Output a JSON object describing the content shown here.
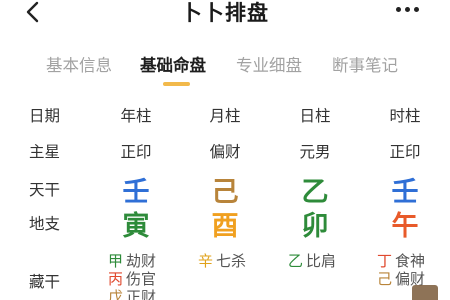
{
  "header": {
    "title": "卜卜排盘",
    "back_icon": "chevron-left-icon",
    "more_icon": "more-horizontal-icon"
  },
  "tabs": [
    {
      "label": "基本信息",
      "active": false
    },
    {
      "label": "基础命盘",
      "active": true
    },
    {
      "label": "专业细盘",
      "active": false
    },
    {
      "label": "断事笔记",
      "active": false
    }
  ],
  "row_labels": {
    "date": "日期",
    "main_star": "主星",
    "tiangan": "天干",
    "dizhi": "地支",
    "canggan": "藏干"
  },
  "columns": [
    {
      "pillar": "年柱",
      "main_star": "正印",
      "tiangan": {
        "char": "壬",
        "color": "#2f6fd6"
      },
      "dizhi": {
        "char": "寅",
        "color": "#2e8b3a"
      },
      "canggan": [
        {
          "stem": "甲",
          "stem_color": "#2e8b3a",
          "god": "劫财"
        },
        {
          "stem": "丙",
          "stem_color": "#e04a2f",
          "god": "伤官"
        },
        {
          "stem": "戊",
          "stem_color": "#b8843a",
          "god": "正财"
        }
      ]
    },
    {
      "pillar": "月柱",
      "main_star": "偏财",
      "tiangan": {
        "char": "己",
        "color": "#b8843a"
      },
      "dizhi": {
        "char": "酉",
        "color": "#f0a020"
      },
      "canggan": [
        {
          "stem": "辛",
          "stem_color": "#e0a21a",
          "god": "七杀"
        }
      ]
    },
    {
      "pillar": "日柱",
      "main_star": "元男",
      "tiangan": {
        "char": "乙",
        "color": "#2e8b3a"
      },
      "dizhi": {
        "char": "卯",
        "color": "#2e8b3a"
      },
      "canggan": [
        {
          "stem": "乙",
          "stem_color": "#2e8b3a",
          "god": "比肩"
        }
      ]
    },
    {
      "pillar": "时柱",
      "main_star": "正印",
      "tiangan": {
        "char": "壬",
        "color": "#2f6fd6"
      },
      "dizhi": {
        "char": "午",
        "color": "#e85a2a"
      },
      "canggan": [
        {
          "stem": "丁",
          "stem_color": "#e04a2f",
          "god": "食神"
        },
        {
          "stem": "己",
          "stem_color": "#b8843a",
          "god": "偏财"
        }
      ]
    }
  ]
}
